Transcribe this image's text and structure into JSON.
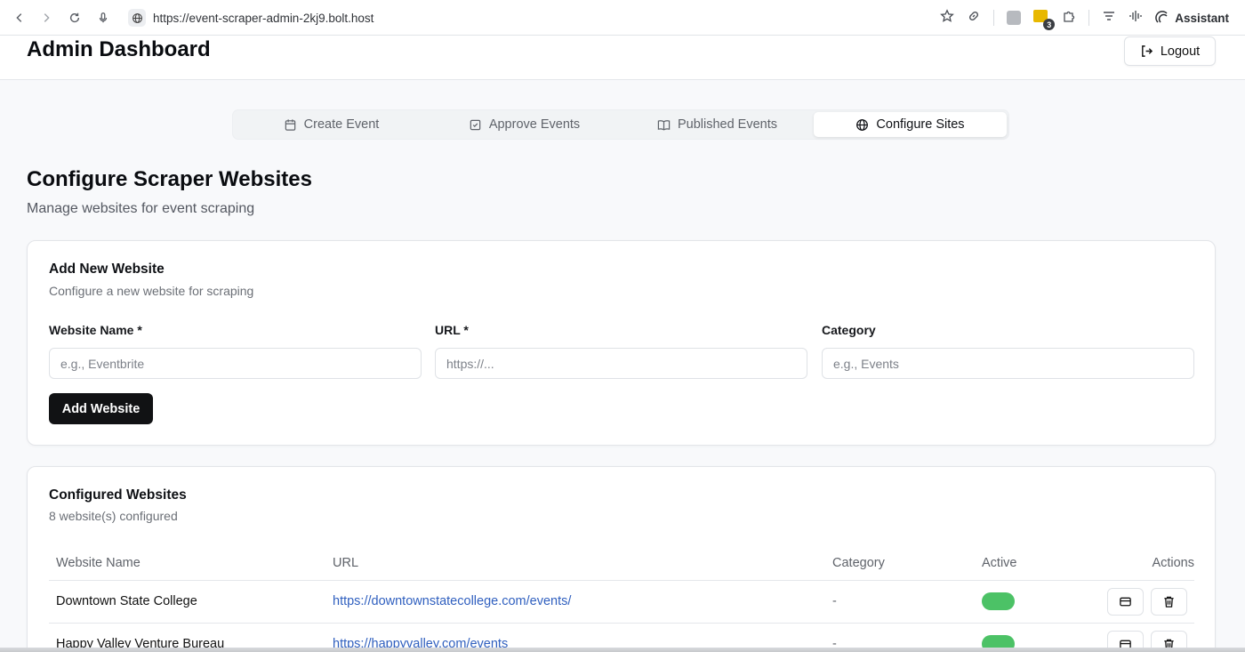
{
  "browser": {
    "url": "https://event-scraper-admin-2kj9.bolt.host",
    "extension_badge": "3",
    "assistant_label": "Assistant"
  },
  "header": {
    "title": "Admin Dashboard",
    "logout_label": "Logout"
  },
  "tabs": [
    {
      "label": "Create Event",
      "icon": "calendar-icon",
      "active": false
    },
    {
      "label": "Approve Events",
      "icon": "check-square-icon",
      "active": false
    },
    {
      "label": "Published Events",
      "icon": "book-open-icon",
      "active": false
    },
    {
      "label": "Configure Sites",
      "icon": "globe-icon",
      "active": true
    }
  ],
  "page": {
    "title": "Configure Scraper Websites",
    "subtitle": "Manage websites for event scraping"
  },
  "add_form": {
    "title": "Add New Website",
    "subtitle": "Configure a new website for scraping",
    "fields": [
      {
        "label": "Website Name *",
        "placeholder": "e.g., Eventbrite",
        "value": ""
      },
      {
        "label": "URL *",
        "placeholder": "https://...",
        "value": ""
      },
      {
        "label": "Category",
        "placeholder": "e.g., Events",
        "value": ""
      }
    ],
    "submit_label": "Add Website"
  },
  "list": {
    "title": "Configured Websites",
    "subtitle": "8 website(s) configured",
    "columns": [
      "Website Name",
      "URL",
      "Category",
      "Active",
      "Actions"
    ],
    "rows": [
      {
        "name": "Downtown State College",
        "url": "https://downtownstatecollege.com/events/",
        "category": "-",
        "active": true
      },
      {
        "name": "Happy Valley Venture Bureau",
        "url": "https://happyvalley.com/events",
        "category": "-",
        "active": true
      }
    ]
  },
  "colors": {
    "accent": "#111214",
    "link": "#2f5fbf",
    "toggle_on": "#4cc266"
  }
}
